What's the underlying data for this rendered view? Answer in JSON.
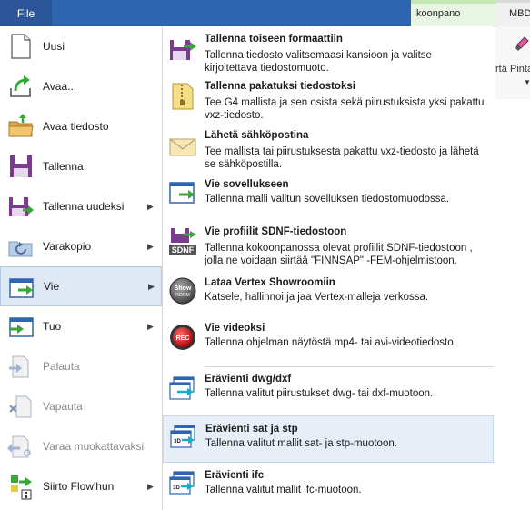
{
  "ribbon": {
    "file_label": "File",
    "tab_koonpano": "koonpano",
    "tab_mbd": "MBD",
    "right_label_a": "rtä",
    "right_label_b": "Pinta"
  },
  "left_menu": [
    {
      "label": "Uusi"
    },
    {
      "label": "Avaa..."
    },
    {
      "label": "Avaa tiedosto"
    },
    {
      "label": "Tallenna"
    },
    {
      "label": "Tallenna uudeksi"
    },
    {
      "label": "Varakopio"
    },
    {
      "label": "Vie"
    },
    {
      "label": "Tuo"
    },
    {
      "label": "Palauta"
    },
    {
      "label": "Vapauta"
    },
    {
      "label": "Varaa muokattavaksi"
    },
    {
      "label": "Siirto Flow'hun"
    }
  ],
  "submenu": [
    {
      "title": "Tallenna toiseen formaattiin",
      "desc": "Tallenna tiedosto valitsemaasi kansioon ja valitse kirjoitettava tiedostomuoto."
    },
    {
      "title": "Tallenna pakatuksi tiedostoksi",
      "desc": "Tee G4 mallista ja sen osista sekä piirustuksista yksi pakattu vxz-tiedosto."
    },
    {
      "title": "Lähetä sähköpostina",
      "desc": "Tee mallista tai piirustuksesta pakattu vxz-tiedosto ja lähetä se sähköpostilla."
    },
    {
      "title": "Vie sovellukseen",
      "desc": "Tallenna malli valitun sovelluksen tiedostomuodossa."
    },
    {
      "title": "Vie profiilit SDNF-tiedostoon",
      "desc": "Tallenna kokoonpanossa olevat profiilit SDNF-tiedostoon , jolla ne voidaan siirtää \"FINNSAP\" -FEM-ohjelmistoon."
    },
    {
      "title": "Lataa Vertex Showroomiin",
      "desc": "Katsele, hallinnoi ja jaa Vertex-malleja verkossa."
    },
    {
      "title": "Vie videoksi",
      "desc": "Tallenna ohjelman näytöstä mp4- tai avi-videotiedosto."
    },
    {
      "title": "Erävienti dwg/dxf",
      "desc": "Tallenna valitut piirustukset dwg- tai dxf-muotoon."
    },
    {
      "title": "Erävienti sat ja stp",
      "desc": "Tallenna valitut mallit sat- ja stp-muotoon."
    },
    {
      "title": "Erävienti ifc",
      "desc": "Tallenna valitut mallit ifc-muotoon."
    }
  ],
  "icon_text": {
    "sdnf": "SDNF",
    "show_a": "Show",
    "show_b": "ROOM",
    "rec": "REC",
    "td": "3D"
  },
  "colors": {
    "file_blue": "#2b579a",
    "purple": "#7a3b8e",
    "green_arrow": "#3aa538",
    "selected_bg": "#dfe9f5",
    "highlight_bg": "#e8eef7"
  }
}
